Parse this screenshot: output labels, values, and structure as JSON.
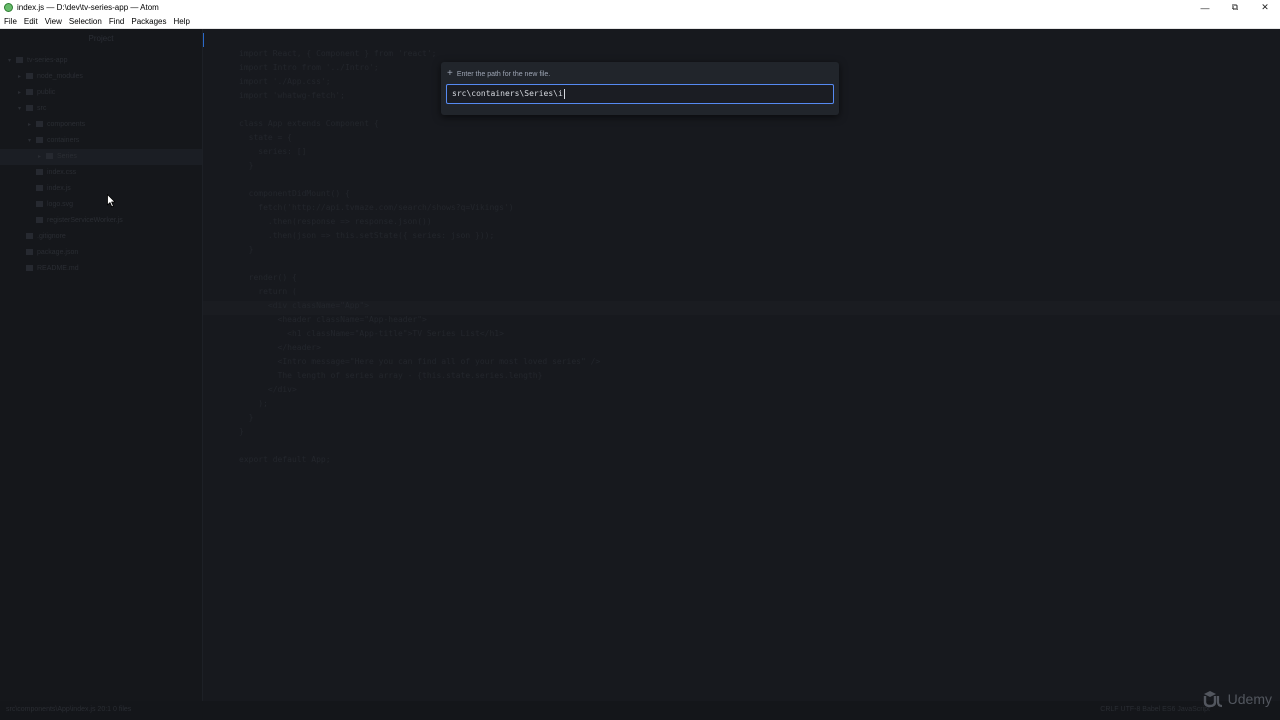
{
  "window": {
    "title": "index.js — D:\\dev\\tv-series-app — Atom",
    "controls": {
      "minimize": "—",
      "maximize": "⧉",
      "close": "✕"
    }
  },
  "menu": [
    "File",
    "Edit",
    "View",
    "Selection",
    "Find",
    "Packages",
    "Help"
  ],
  "sidebar": {
    "header": "Project",
    "tree": [
      {
        "label": "tv-series-app",
        "depth": 0,
        "type": "folder",
        "expanded": true
      },
      {
        "label": "node_modules",
        "depth": 1,
        "type": "folder",
        "expanded": false
      },
      {
        "label": "public",
        "depth": 1,
        "type": "folder",
        "expanded": false
      },
      {
        "label": "src",
        "depth": 1,
        "type": "folder",
        "expanded": true
      },
      {
        "label": "components",
        "depth": 2,
        "type": "folder",
        "expanded": false
      },
      {
        "label": "containers",
        "depth": 2,
        "type": "folder",
        "expanded": true
      },
      {
        "label": "Series",
        "depth": 3,
        "type": "folder",
        "expanded": false,
        "selected": true
      },
      {
        "label": "index.css",
        "depth": 2,
        "type": "file"
      },
      {
        "label": "index.js",
        "depth": 2,
        "type": "file"
      },
      {
        "label": "logo.svg",
        "depth": 2,
        "type": "file"
      },
      {
        "label": "registerServiceWorker.js",
        "depth": 2,
        "type": "file"
      },
      {
        "label": ".gitignore",
        "depth": 1,
        "type": "file"
      },
      {
        "label": "package.json",
        "depth": 1,
        "type": "file"
      },
      {
        "label": "README.md",
        "depth": 1,
        "type": "file"
      }
    ]
  },
  "editor": {
    "lines": [
      "import React, { Component } from 'react';",
      "import Intro from '../Intro';",
      "import './App.css';",
      "import 'whatwg-fetch';",
      "",
      "class App extends Component {",
      "  state = {",
      "    series: []",
      "  }",
      "",
      "  componentDidMount() {",
      "    fetch('http://api.tvmaze.com/search/shows?q=Vikings')",
      "      .then(response => response.json())",
      "      .then(json => this.setState({ series: json }));",
      "  }",
      "",
      "  render() {",
      "    return (",
      "      <div className=\"App\">",
      "        <header className=\"App-header\">",
      "          <h1 className=\"App-title\">TV Series List</h1>",
      "        </header>",
      "        <Intro message=\"Here you can find all of your most loved series\" />",
      "        The length of series array - {this.state.series.length}",
      "      </div>",
      "    );",
      "  }",
      "}",
      "",
      "export default App;"
    ]
  },
  "dialog": {
    "label": "Enter the path for the new file.",
    "value": "src\\containers\\Series\\i"
  },
  "status": {
    "left": "src\\components\\App\\index.js   20:1   0 files",
    "right": "CRLF   UTF-8   Babel ES6 JavaScript"
  },
  "watermark": "Udemy",
  "colors": {
    "accent": "#568af2",
    "background": "#16181d"
  }
}
